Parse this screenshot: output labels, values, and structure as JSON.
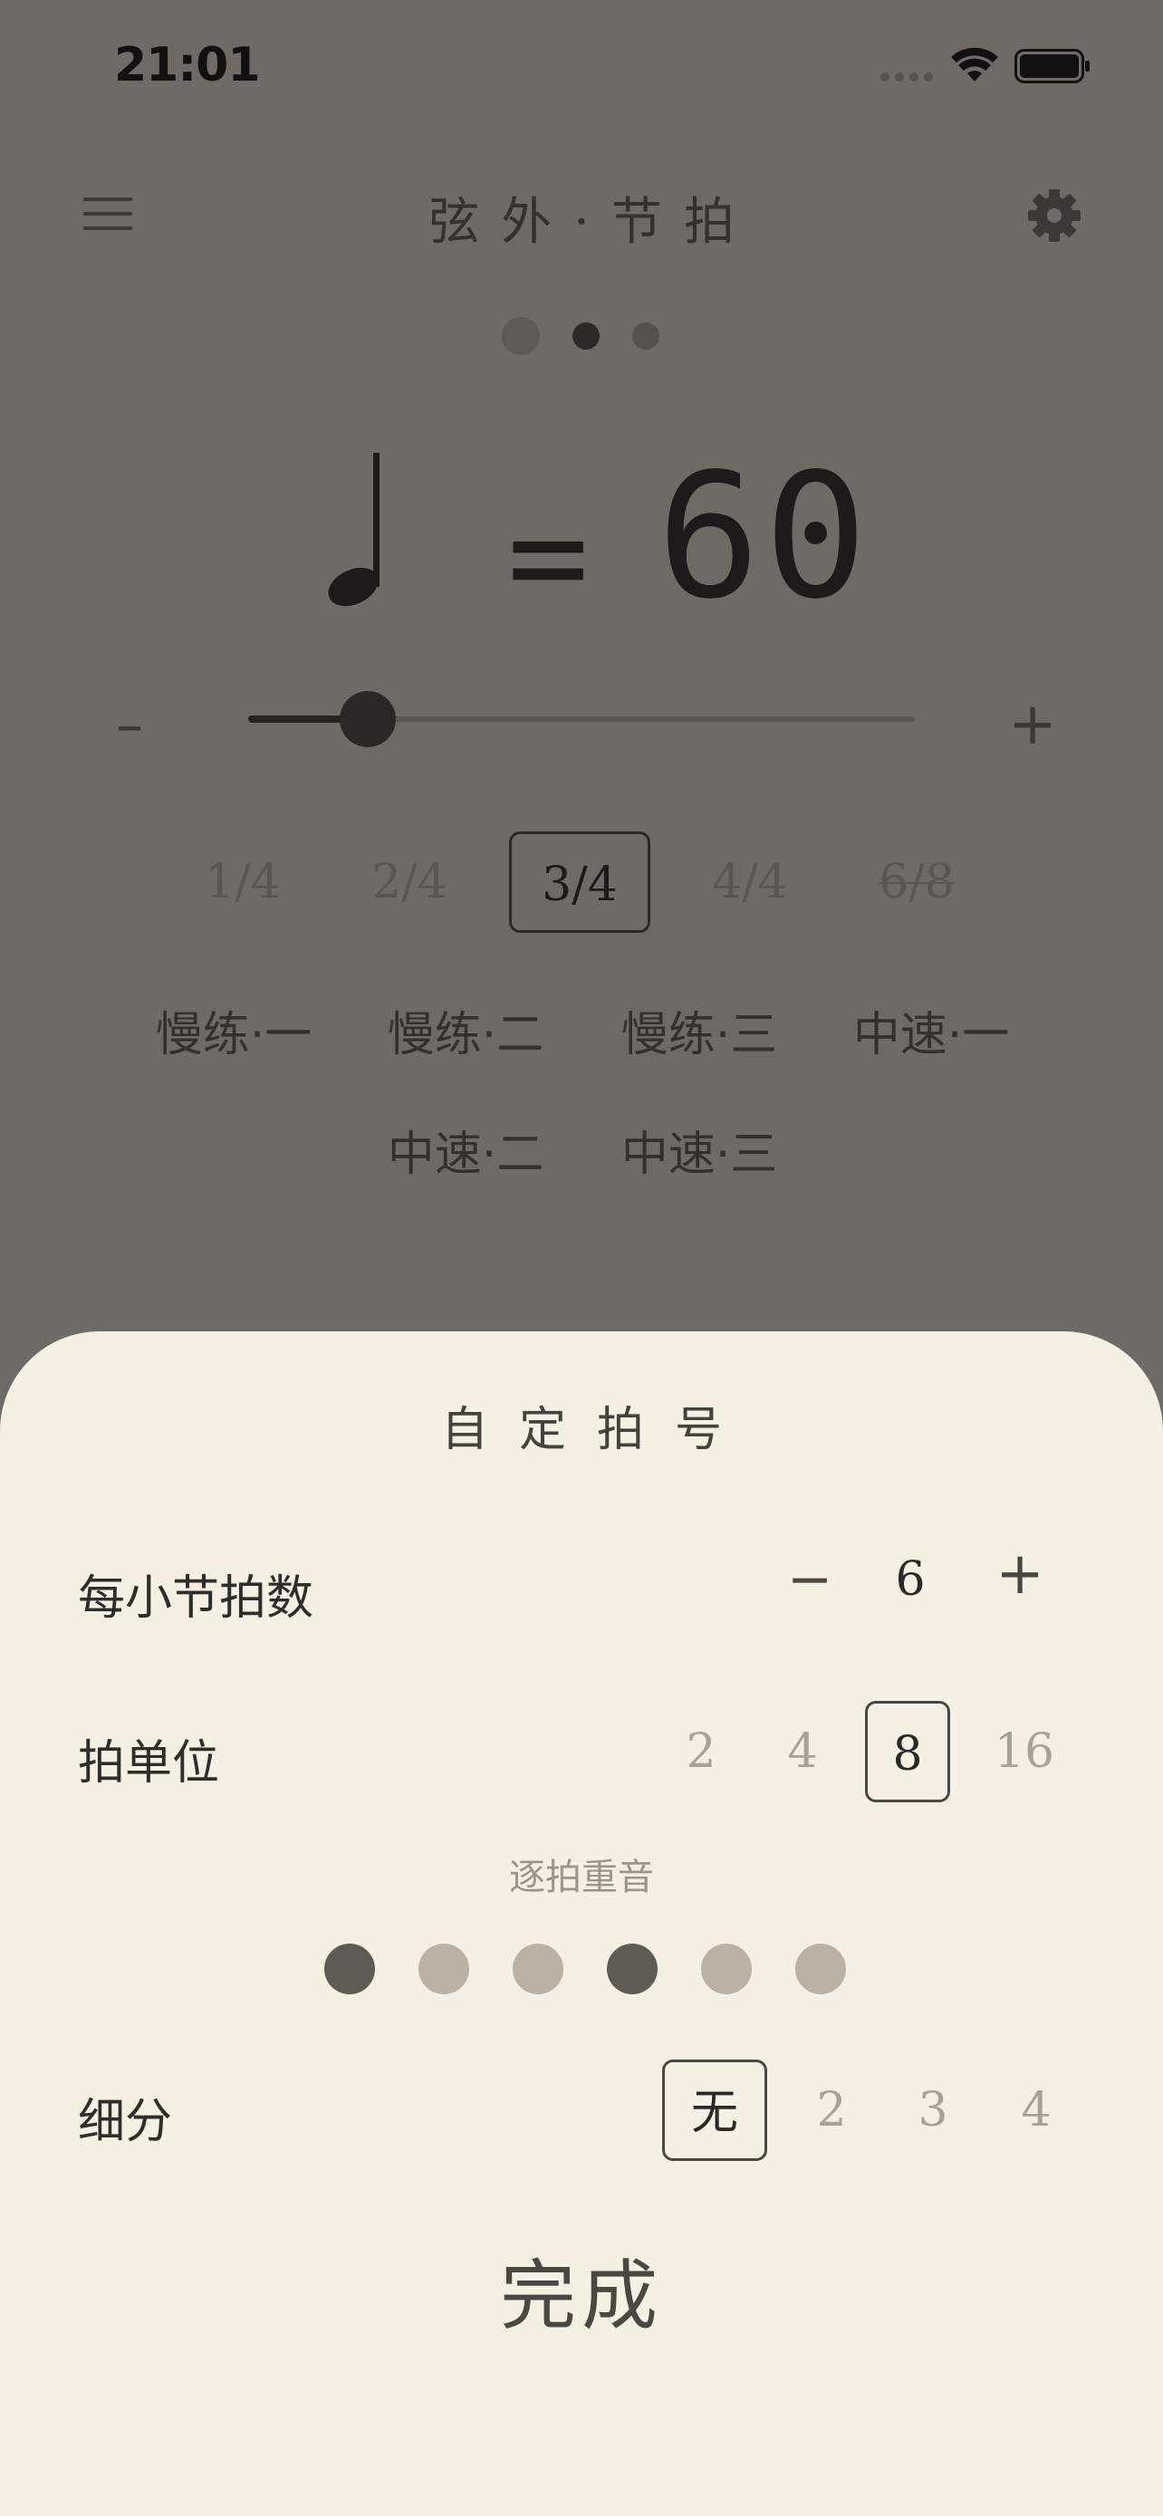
{
  "status_bar": {
    "time": "21:01"
  },
  "header": {
    "title": "弦外·节拍",
    "menu_icon": "hamburger-menu-icon",
    "settings_icon": "gear-icon"
  },
  "pager": {
    "pages": 3,
    "current": 2
  },
  "tempo": {
    "note_icon": "quarter-note-icon",
    "equals": "=",
    "bpm": "60",
    "slider_fraction": 0.18,
    "minus_label": "–",
    "plus_label": "+"
  },
  "time_signatures": {
    "options": [
      "1/4",
      "2/4",
      "3/4",
      "4/4",
      "6/8"
    ],
    "selected": "3/4"
  },
  "presets": [
    "慢练·一",
    "慢练·二",
    "慢练·三",
    "中速·一",
    "中速·二",
    "中速·三"
  ],
  "sheet": {
    "title": "自定拍号",
    "beats_per_bar": {
      "label": "每小节拍数",
      "minus": "−",
      "value": "6",
      "plus": "+"
    },
    "beat_unit": {
      "label": "拍单位",
      "options": [
        "2",
        "4",
        "8",
        "16"
      ],
      "selected": "8"
    },
    "accents": {
      "label": "逐拍重音",
      "pattern": [
        true,
        false,
        false,
        true,
        false,
        false
      ]
    },
    "subdivision": {
      "label": "细分",
      "options": [
        "无",
        "2",
        "3",
        "4"
      ],
      "selected": "无"
    },
    "done_label": "完成"
  },
  "colors": {
    "overlay_background": "#6e6b66",
    "sheet_background": "#f5efe4",
    "accent_on": "#5f5a53",
    "accent_off": "#bbb2a3"
  }
}
